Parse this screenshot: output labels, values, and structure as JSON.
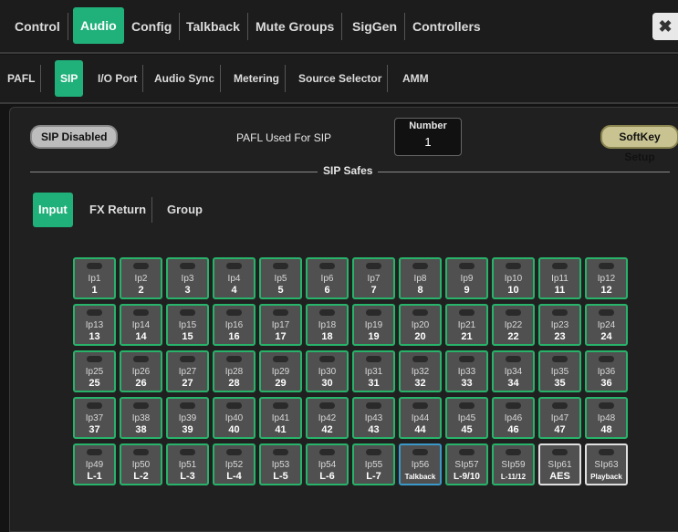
{
  "top_tabs": [
    "Control",
    "Audio",
    "Config",
    "Talkback",
    "Mute Groups",
    "SigGen",
    "Controllers"
  ],
  "top_active": "Audio",
  "close_glyph": "✖",
  "sub_tabs": [
    "PAFL",
    "SIP",
    "I/O Port",
    "Audio Sync",
    "Metering",
    "Source Selector",
    "AMM"
  ],
  "sub_active": "SIP",
  "panel": {
    "sip_disabled_label": "SIP Disabled",
    "pafl_used_text": "PAFL Used For SIP",
    "number_label": "Number",
    "number_value": "1",
    "softkey_label": "SoftKey Setup",
    "section_title": "SIP Safes"
  },
  "channel_tabs": [
    "Input",
    "FX Return",
    "Group"
  ],
  "channel_active": "Input",
  "colors": {
    "accent": "#20b07a",
    "cell_border": "#27b36a",
    "talkback_border": "#3a99c9",
    "white_border": "#e0e0e0"
  },
  "grid_rows": [
    [
      {
        "top": "Ip1",
        "bottom": "1"
      },
      {
        "top": "Ip2",
        "bottom": "2"
      },
      {
        "top": "Ip3",
        "bottom": "3"
      },
      {
        "top": "Ip4",
        "bottom": "4"
      },
      {
        "top": "Ip5",
        "bottom": "5"
      },
      {
        "top": "Ip6",
        "bottom": "6"
      },
      {
        "top": "Ip7",
        "bottom": "7"
      },
      {
        "top": "Ip8",
        "bottom": "8"
      },
      {
        "top": "Ip9",
        "bottom": "9"
      },
      {
        "top": "Ip10",
        "bottom": "10"
      },
      {
        "top": "Ip11",
        "bottom": "11"
      },
      {
        "top": "Ip12",
        "bottom": "12"
      }
    ],
    [
      {
        "top": "Ip13",
        "bottom": "13"
      },
      {
        "top": "Ip14",
        "bottom": "14"
      },
      {
        "top": "Ip15",
        "bottom": "15"
      },
      {
        "top": "Ip16",
        "bottom": "16"
      },
      {
        "top": "Ip17",
        "bottom": "17"
      },
      {
        "top": "Ip18",
        "bottom": "18"
      },
      {
        "top": "Ip19",
        "bottom": "19"
      },
      {
        "top": "Ip20",
        "bottom": "20"
      },
      {
        "top": "Ip21",
        "bottom": "21"
      },
      {
        "top": "Ip22",
        "bottom": "22"
      },
      {
        "top": "Ip23",
        "bottom": "23"
      },
      {
        "top": "Ip24",
        "bottom": "24"
      }
    ],
    [
      {
        "top": "Ip25",
        "bottom": "25"
      },
      {
        "top": "Ip26",
        "bottom": "26"
      },
      {
        "top": "Ip27",
        "bottom": "27"
      },
      {
        "top": "Ip28",
        "bottom": "28"
      },
      {
        "top": "Ip29",
        "bottom": "29"
      },
      {
        "top": "Ip30",
        "bottom": "30"
      },
      {
        "top": "Ip31",
        "bottom": "31"
      },
      {
        "top": "Ip32",
        "bottom": "32"
      },
      {
        "top": "Ip33",
        "bottom": "33"
      },
      {
        "top": "Ip34",
        "bottom": "34"
      },
      {
        "top": "Ip35",
        "bottom": "35"
      },
      {
        "top": "Ip36",
        "bottom": "36"
      }
    ],
    [
      {
        "top": "Ip37",
        "bottom": "37"
      },
      {
        "top": "Ip38",
        "bottom": "38"
      },
      {
        "top": "Ip39",
        "bottom": "39"
      },
      {
        "top": "Ip40",
        "bottom": "40"
      },
      {
        "top": "Ip41",
        "bottom": "41"
      },
      {
        "top": "Ip42",
        "bottom": "42"
      },
      {
        "top": "Ip43",
        "bottom": "43"
      },
      {
        "top": "Ip44",
        "bottom": "44"
      },
      {
        "top": "Ip45",
        "bottom": "45"
      },
      {
        "top": "Ip46",
        "bottom": "46"
      },
      {
        "top": "Ip47",
        "bottom": "47"
      },
      {
        "top": "Ip48",
        "bottom": "48"
      }
    ],
    [
      {
        "top": "Ip49",
        "bottom": "L-1"
      },
      {
        "top": "Ip50",
        "bottom": "L-2"
      },
      {
        "top": "Ip51",
        "bottom": "L-3"
      },
      {
        "top": "Ip52",
        "bottom": "L-4"
      },
      {
        "top": "Ip53",
        "bottom": "L-5"
      },
      {
        "top": "Ip54",
        "bottom": "L-6"
      },
      {
        "top": "Ip55",
        "bottom": "L-7"
      },
      {
        "top": "Ip56",
        "bottom": "Talkback",
        "style": "blue"
      },
      {
        "top": "SIp57",
        "bottom": "L-9/10"
      },
      {
        "top": "SIp59",
        "bottom": "L-11/12"
      },
      {
        "top": "SIp61",
        "bottom": "AES",
        "style": "white"
      },
      {
        "top": "SIp63",
        "bottom": "Playback",
        "style": "white"
      }
    ]
  ]
}
